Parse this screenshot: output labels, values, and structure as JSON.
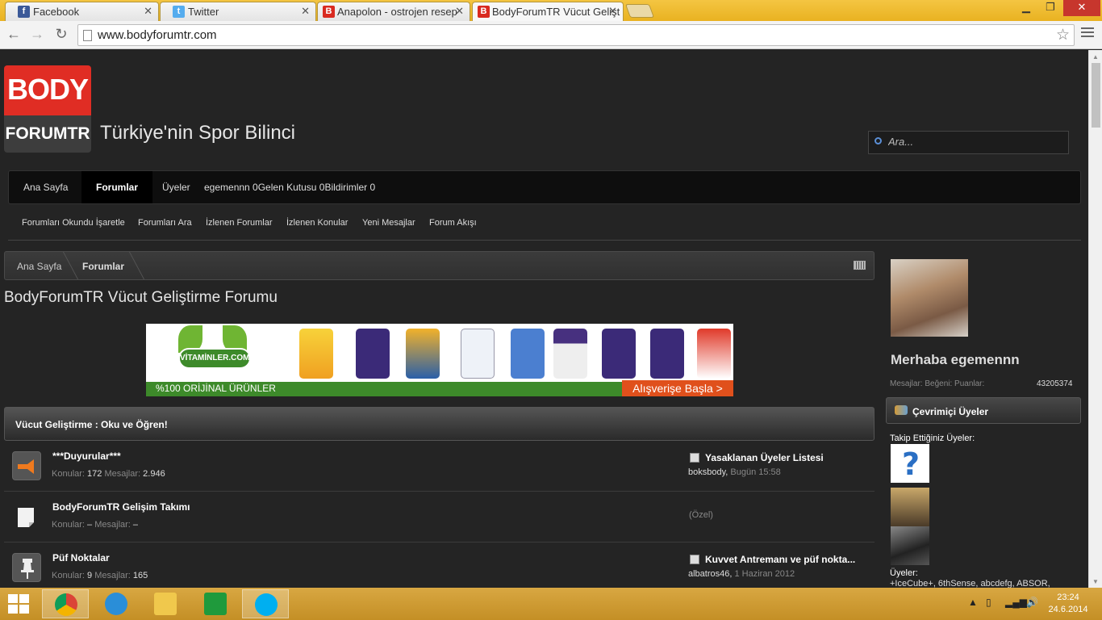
{
  "browser": {
    "tabs": [
      {
        "title": "Facebook",
        "favicon": "facebook-icon",
        "color": "#3b5998",
        "glyph": "f"
      },
      {
        "title": "Twitter",
        "favicon": "twitter-icon",
        "color": "#55acee",
        "glyph": "t"
      },
      {
        "title": "Anapolon - ostrojen resep",
        "favicon": "bodyforumtr-icon",
        "color": "#d92a20",
        "glyph": "B"
      },
      {
        "title": "BodyForumTR Vücut Gelişt",
        "favicon": "bodyforumtr-icon",
        "color": "#d92a20",
        "glyph": "B"
      }
    ],
    "url": "www.bodyforumtr.com"
  },
  "site": {
    "logo_top": "BODY",
    "logo_bottom": "FORUMTR",
    "slogan": "Türkiye'nin Spor Bilinci",
    "search_placeholder": "Ara..."
  },
  "nav": {
    "items": [
      "Ana Sayfa",
      "Forumlar",
      "Üyeler",
      "egemennn 0Gelen Kutusu 0Bildirimler 0"
    ],
    "subitems": [
      "Forumları Okundu İşaretle",
      "Forumları Ara",
      "İzlenen Forumlar",
      "İzlenen Konular",
      "Yeni Mesajlar",
      "Forum Akışı"
    ]
  },
  "breadcrumb": {
    "home": "Ana Sayfa",
    "current": "Forumlar"
  },
  "page_title": "BodyForumTR Vücut Geliştirme Forumu",
  "banner": {
    "brand": "VİTAMİNLER.COM",
    "tagline": "%100 ORİJİNAL ÜRÜNLER",
    "cta": "Alışverişe Başla >"
  },
  "category": {
    "title": "Vücut Geliştirme : Oku ve Öğren!",
    "forums": [
      {
        "title": "***Duyurular***",
        "icon": "megaphone-icon",
        "topics_label": "Konular:",
        "topics": "172",
        "posts_label": "Mesajlar:",
        "posts": "2.946",
        "last_title": "Yasaklanan Üyeler Listesi",
        "last_user": "boksbody,",
        "last_time": "Bugün 15:58",
        "private": ""
      },
      {
        "title": "BodyForumTR Gelişim Takımı",
        "icon": "notepad-icon",
        "topics_label": "Konular:",
        "topics": "–",
        "posts_label": "Mesajlar:",
        "posts": "–",
        "last_title": "",
        "last_user": "",
        "last_time": "",
        "private": "(Özel)"
      },
      {
        "title": "Püf Noktalar",
        "icon": "pin-icon",
        "topics_label": "Konular:",
        "topics": "9",
        "posts_label": "Mesajlar:",
        "posts": "165",
        "last_title": "Kuvvet Antremanı ve püf nokta...",
        "last_user": "albatros46,",
        "last_time": "1 Haziran 2012",
        "private": ""
      }
    ]
  },
  "sidebar": {
    "greeting": "Merhaba egemennn",
    "stats_label": "Mesajlar: Beğeni: Puanlar:",
    "stats_value": "43205374",
    "online_title": "Çevrimiçi Üyeler",
    "following_label": "Takip Ettiğiniz Üyeler:",
    "members_label": "Üyeler:",
    "members_list": "+IceCube+, 6thSense, abcdefg, ABSOR,"
  },
  "taskbar": {
    "time": "23:24",
    "date": "24.6.2014"
  }
}
